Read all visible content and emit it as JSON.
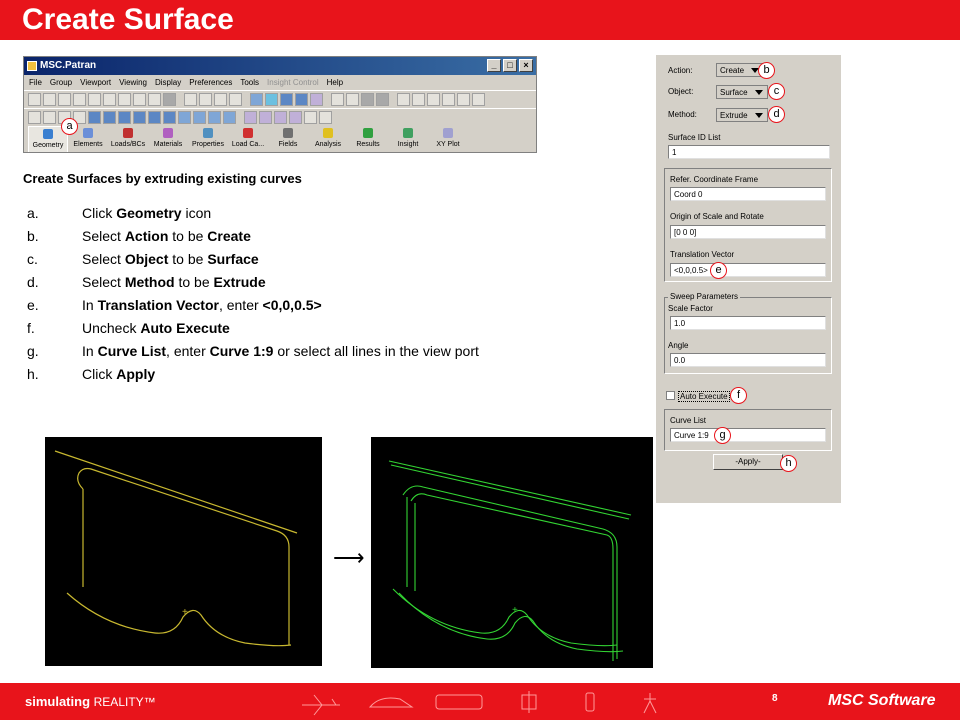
{
  "title": "Create Surface",
  "patran": {
    "window_title": "MSC.Patran",
    "menu": [
      "File",
      "Group",
      "Viewport",
      "Viewing",
      "Display",
      "Preferences",
      "Tools",
      "Insight Control",
      "Help"
    ],
    "apps": [
      "Geometry",
      "Elements",
      "Loads/BCs",
      "Materials",
      "Properties",
      "Load Ca...",
      "Fields",
      "Analysis",
      "Results",
      "Insight",
      "XY Plot"
    ]
  },
  "subtitle": "Create Surfaces by extruding existing curves",
  "steps": [
    {
      "mark": "a.",
      "parts": [
        "Click ",
        "Geometry",
        " icon"
      ]
    },
    {
      "mark": "b.",
      "parts": [
        "Select ",
        "Action",
        " to be ",
        "Create"
      ]
    },
    {
      "mark": "c.",
      "parts": [
        "Select ",
        "Object",
        " to be ",
        "Surface"
      ]
    },
    {
      "mark": "d.",
      "parts": [
        "Select ",
        "Method",
        " to be ",
        "Extrude"
      ]
    },
    {
      "mark": "e.",
      "parts": [
        "In ",
        "Translation Vector",
        ", enter ",
        "<0,0,0.5>"
      ]
    },
    {
      "mark": "f.",
      "parts": [
        "Uncheck ",
        "Auto Execute"
      ]
    },
    {
      "mark": "g.",
      "parts": [
        "In ",
        "Curve List",
        ", enter ",
        "Curve 1:9",
        " or select all lines in the view port"
      ]
    },
    {
      "mark": "h.",
      "parts": [
        "Click ",
        "Apply"
      ]
    }
  ],
  "panel": {
    "action_label": "Action:",
    "action_value": "Create",
    "object_label": "Object:",
    "object_value": "Surface",
    "method_label": "Method:",
    "method_value": "Extrude",
    "surface_id_label": "Surface ID List",
    "surface_id_value": "1",
    "coord_frame_label": "Refer. Coordinate Frame",
    "coord_frame_value": "Coord 0",
    "origin_label": "Origin of Scale and Rotate",
    "origin_value": "[0 0 0]",
    "translation_label": "Translation Vector",
    "translation_value": "<0,0,0.5>",
    "sweep_label": "Sweep Parameters",
    "scale_label": "Scale Factor",
    "scale_value": "1.0",
    "angle_label": "Angle",
    "angle_value": "0.0",
    "auto_execute_label": "Auto Execute",
    "curve_list_label": "Curve List",
    "curve_list_value": "Curve 1:9",
    "apply_label": "-Apply-"
  },
  "callouts": {
    "a": "a",
    "b": "b",
    "c": "c",
    "d": "d",
    "e": "e",
    "f": "f",
    "g": "g",
    "h": "h"
  },
  "footer": {
    "brand": "simulating",
    "brand_tail": "REALITY™",
    "page": "8",
    "company": "MSC Software"
  },
  "colors": {
    "accent": "#e8141b",
    "curve_before": "#c8b830",
    "curve_after": "#33d433"
  }
}
